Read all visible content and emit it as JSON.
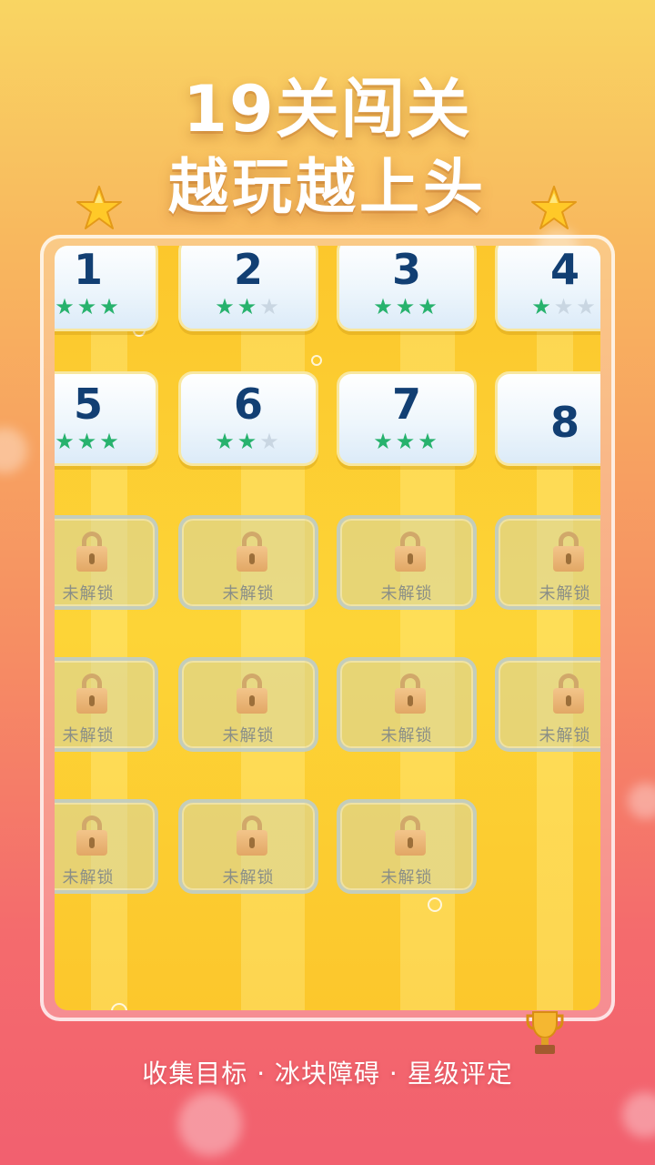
{
  "headline": {
    "line1": "19关闯关",
    "line2": "越玩越上头"
  },
  "footer": {
    "tagline": "收集目标 · 冰块障碍 · 星级评定"
  },
  "colors": {
    "star_earned": "#27b26d",
    "star_empty": "#c9d6e2",
    "level_number": "#123f73",
    "panel_yellow": "#fcc72c"
  },
  "levels": [
    {
      "number": "1",
      "stars": 3,
      "locked": false
    },
    {
      "number": "2",
      "stars": 2,
      "locked": false
    },
    {
      "number": "3",
      "stars": 3,
      "locked": false
    },
    {
      "number": "4",
      "stars": 1,
      "locked": false
    },
    {
      "number": "5",
      "stars": 3,
      "locked": false
    },
    {
      "number": "6",
      "stars": 2,
      "locked": false
    },
    {
      "number": "7",
      "stars": 3,
      "locked": false
    },
    {
      "number": "8",
      "stars": null,
      "locked": false
    },
    {
      "locked": true,
      "label": "未解锁"
    },
    {
      "locked": true,
      "label": "未解锁"
    },
    {
      "locked": true,
      "label": "未解锁"
    },
    {
      "locked": true,
      "label": "未解锁"
    },
    {
      "locked": true,
      "label": "未解锁"
    },
    {
      "locked": true,
      "label": "未解锁"
    },
    {
      "locked": true,
      "label": "未解锁"
    },
    {
      "locked": true,
      "label": "未解锁"
    },
    {
      "locked": true,
      "label": "未解锁"
    },
    {
      "locked": true,
      "label": "未解锁"
    },
    {
      "locked": true,
      "label": "未解锁"
    }
  ],
  "icons": {
    "corner": "star-icon",
    "lock": "padlock-icon",
    "trophy": "trophy-icon"
  }
}
